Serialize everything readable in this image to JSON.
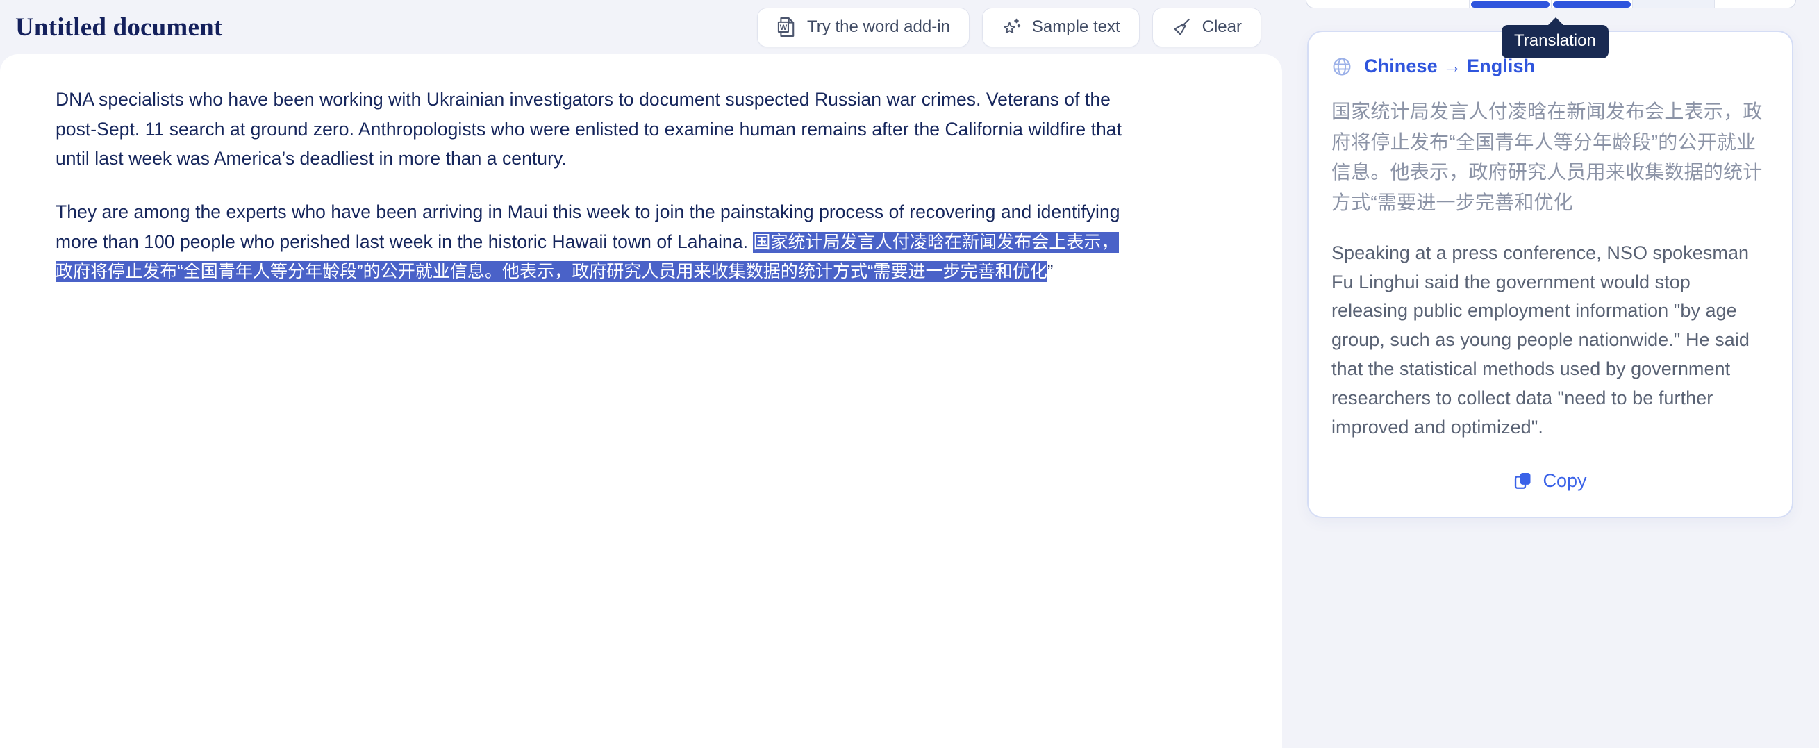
{
  "document": {
    "title": "Untitled document",
    "paragraphs": [
      {
        "id": "p1",
        "text": "DNA specialists who have been working with Ukrainian investigators to document suspected Russian war crimes. Veterans of the post-Sept. 11 search at ground zero. Anthropologists who were enlisted to examine human remains after the California wildfire that until last week was America’s deadliest in more than a century."
      },
      {
        "id": "p2",
        "lead": "They are among the experts who have been arriving in Maui this week to join the painstaking process of recovering and identifying more than 100 people who perished last week in the historic Hawaii town of Lahaina.",
        "selected": "国家统计局发言人付凌晗在新闻发布会上表示，政府将停止发布“全国青年人等分年龄段”的公开就业信息。他表示，政府研究人员用来收集数据的统计方式“需要进一步完善和优化",
        "unselected_tail": "”"
      }
    ]
  },
  "toolbar": {
    "word_addin_label": "Try the word add-in",
    "word_addin_icon": "word-document-icon",
    "sample_text_label": "Sample text",
    "sample_text_icon": "sparkle-star-icon",
    "clear_label": "Clear",
    "clear_icon": "broom-icon"
  },
  "panel": {
    "tooltip": "Translation",
    "tabs": [
      {
        "id": "tab-1",
        "state": "normal"
      },
      {
        "id": "tab-2",
        "state": "normal"
      },
      {
        "id": "tab-3",
        "state": "active"
      },
      {
        "id": "tab-4",
        "state": "active"
      },
      {
        "id": "tab-5",
        "state": "dim"
      },
      {
        "id": "tab-6",
        "state": "normal"
      }
    ],
    "translation": {
      "globe_icon": "globe-icon",
      "language_pair": "Chinese → English",
      "source_text": "国家统计局发言人付凌晗在新闻发布会上表示，政府将停止发布“全国青年人等分年龄段”的公开就业信息。他表示，政府研究人员用来收集数据的统计方式“需要进一步完善和优化",
      "translated_text": "Speaking at a press conference, NSO spokesman Fu Linghui said the government would stop releasing public employment information \"by age group, such as young people nationwide.\" He said that the statistical methods used by government researchers to collect data \"need to be further improved and optimized\".",
      "copy_label": "Copy",
      "copy_icon": "copy-icon"
    }
  },
  "colors": {
    "page_background": "#f2f3f9",
    "card_background": "#ffffff",
    "title_navy": "#14205c",
    "body_navy": "#16265c",
    "selection_blue": "#4a62c8",
    "accent_blue": "#2f55dd",
    "copy_blue": "#3a62e8",
    "tooltip_navy": "#192a52",
    "source_gray": "#8b93a6",
    "translated_gray": "#596274",
    "card_border": "#d5ddf5"
  }
}
